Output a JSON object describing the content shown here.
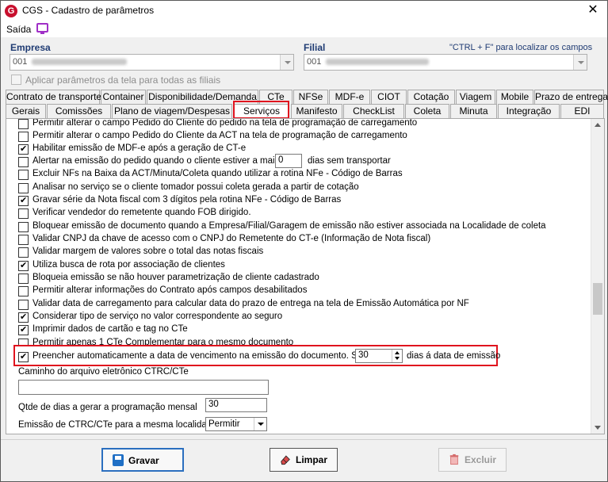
{
  "window": {
    "title": "CGS - Cadastro de parâmetros",
    "app_icon": "G",
    "close_symbol": "✕"
  },
  "menu": {
    "saida": "Saída"
  },
  "empresa": {
    "label": "Empresa",
    "value": "001"
  },
  "filial": {
    "label": "Filial",
    "value": "001"
  },
  "hint": "\"CTRL + F\" para localizar os campos",
  "apply_all": {
    "label": "Aplicar parâmetros da tela para todas as filiais",
    "checked": false
  },
  "tabs_row1": [
    "Contrato de transporte",
    "Container",
    "Disponibilidade/Demanda",
    "CTe",
    "NFSe",
    "MDF-e",
    "CIOT",
    "Cotação",
    "Viagem",
    "Mobile",
    "Prazo de entrega"
  ],
  "tabs_row2": [
    "Gerais",
    "Comissões",
    "Plano de viagem/Despesas",
    "Serviços",
    "Manifesto",
    "CheckList",
    "Coleta",
    "Minuta",
    "Integração",
    "EDI"
  ],
  "active_tab": "Serviços",
  "options": [
    {
      "label": "Permitir alterar o campo Pedido do Cliente do pedido na tela de programação de carregamento",
      "checked": false
    },
    {
      "label": "Permitir alterar o campo Pedido do Cliente da ACT na tela de programação de carregamento",
      "checked": false
    },
    {
      "label": "Habilitar emissão de MDF-e após a geração de CT-e",
      "checked": true
    },
    {
      "label": "Alertar na emissão do pedido quando o cliente estiver a mais de",
      "checked": false,
      "value": "0",
      "suffix": "dias sem transportar"
    },
    {
      "label": "Excluir NFs na Baixa da ACT/Minuta/Coleta quando utilizar a rotina NFe - Código de Barras",
      "checked": false
    },
    {
      "label": "Analisar no serviço se o cliente tomador possui coleta gerada a partir de cotação",
      "checked": false
    },
    {
      "label": "Gravar série da Nota fiscal com 3 dígitos pela rotina NFe - Código de Barras",
      "checked": true
    },
    {
      "label": "Verificar vendedor do remetente quando FOB dirigido.",
      "checked": false
    },
    {
      "label": "Bloquear emissão de documento quando a Empresa/Filial/Garagem de emissão não estiver associada na Localidade de coleta",
      "checked": false
    },
    {
      "label": "Validar CNPJ da chave de acesso com o CNPJ do Remetente do CT-e (Informação de Nota fiscal)",
      "checked": false
    },
    {
      "label": "Validar margem de valores sobre o total das notas fiscais",
      "checked": false
    },
    {
      "label": "Utiliza busca de rota por associação de clientes",
      "checked": true
    },
    {
      "label": "Bloqueia emissão se não houver parametrização de cliente cadastrado",
      "checked": false
    },
    {
      "label": "Permitir alterar informações do Contrato após campos desabilitados",
      "checked": false
    },
    {
      "label": "Validar data de carregamento para calcular data do prazo de entrega na tela de  Emissão Automática por NF",
      "checked": false
    },
    {
      "label": "Considerar tipo de serviço no valor correspondente ao seguro",
      "checked": true
    },
    {
      "label": "Imprimir dados de cartão e tag no CTe",
      "checked": true
    },
    {
      "label": "Permitir apenas 1 CTe Complementar para o mesmo documento",
      "checked": false
    },
    {
      "label": "Preencher automaticamente a data de vencimento na emissão do documento. Somar",
      "checked": true,
      "value": "30",
      "suffix": "dias á data de emissão"
    }
  ],
  "caminho": {
    "label": "Caminho do arquivo eletrônico CTRC/CTe",
    "value": ""
  },
  "qtde": {
    "label": "Qtde de dias a gerar a programação mensal",
    "value": "30"
  },
  "emissao_localidade": {
    "label": "Emissão de CTRC/CTe para a mesma localidade",
    "value": "Permitir"
  },
  "buttons": {
    "save": "Gravar",
    "clear": "Limpar",
    "delete": "Excluir"
  },
  "colors": {
    "highlight": "#e0131e",
    "label_blue": "#1f3b73",
    "accent_purple": "#a02fc7",
    "brand_red": "#c8102e"
  }
}
